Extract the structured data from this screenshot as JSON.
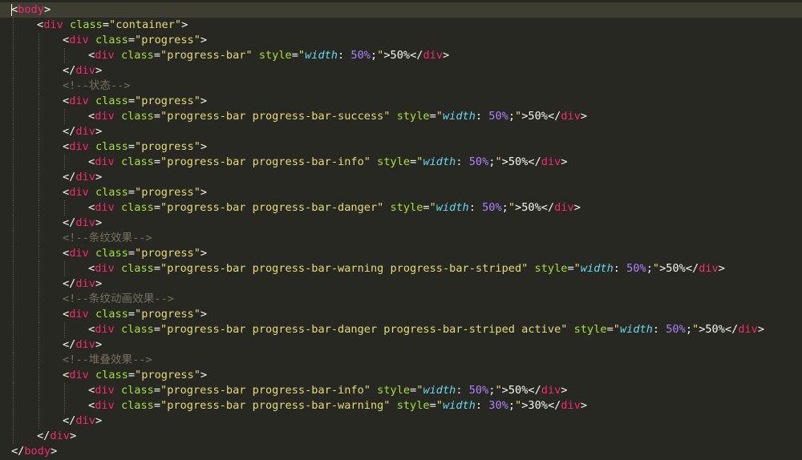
{
  "editor": {
    "lines": [
      {
        "indent": 0,
        "current": true,
        "tokens": [
          [
            "p",
            "<"
          ],
          [
            "t",
            "body"
          ],
          [
            "p",
            ">"
          ]
        ]
      },
      {
        "indent": 1,
        "tokens": [
          [
            "p",
            "<"
          ],
          [
            "t",
            "div"
          ],
          [
            "p",
            " "
          ],
          [
            "a",
            "class"
          ],
          [
            "p",
            "="
          ],
          [
            "s",
            "\"container\""
          ],
          [
            "p",
            ">"
          ]
        ]
      },
      {
        "indent": 2,
        "tokens": [
          [
            "p",
            "<"
          ],
          [
            "t",
            "div"
          ],
          [
            "p",
            " "
          ],
          [
            "a",
            "class"
          ],
          [
            "p",
            "="
          ],
          [
            "s",
            "\"progress\""
          ],
          [
            "p",
            ">"
          ]
        ]
      },
      {
        "indent": 3,
        "tokens": [
          [
            "p",
            "<"
          ],
          [
            "t",
            "div"
          ],
          [
            "p",
            " "
          ],
          [
            "a",
            "class"
          ],
          [
            "p",
            "="
          ],
          [
            "s",
            "\"progress-bar\""
          ],
          [
            "p",
            " "
          ],
          [
            "a",
            "style"
          ],
          [
            "p",
            "="
          ],
          [
            "s",
            "\""
          ],
          [
            "prop",
            "width"
          ],
          [
            "p",
            ": "
          ],
          [
            "num",
            "50%"
          ],
          [
            "p",
            ";"
          ],
          [
            "s",
            "\""
          ],
          [
            "p",
            ">50%</"
          ],
          [
            "t",
            "div"
          ],
          [
            "p",
            ">"
          ]
        ]
      },
      {
        "indent": 2,
        "tokens": [
          [
            "p",
            "</"
          ],
          [
            "t",
            "div"
          ],
          [
            "p",
            ">"
          ]
        ]
      },
      {
        "indent": 2,
        "tokens": [
          [
            "c",
            "<!--状态-->"
          ]
        ]
      },
      {
        "indent": 2,
        "tokens": [
          [
            "p",
            "<"
          ],
          [
            "t",
            "div"
          ],
          [
            "p",
            " "
          ],
          [
            "a",
            "class"
          ],
          [
            "p",
            "="
          ],
          [
            "s",
            "\"progress\""
          ],
          [
            "p",
            ">"
          ]
        ]
      },
      {
        "indent": 3,
        "tokens": [
          [
            "p",
            "<"
          ],
          [
            "t",
            "div"
          ],
          [
            "p",
            " "
          ],
          [
            "a",
            "class"
          ],
          [
            "p",
            "="
          ],
          [
            "s",
            "\"progress-bar progress-bar-success\""
          ],
          [
            "p",
            " "
          ],
          [
            "a",
            "style"
          ],
          [
            "p",
            "="
          ],
          [
            "s",
            "\""
          ],
          [
            "prop",
            "width"
          ],
          [
            "p",
            ": "
          ],
          [
            "num",
            "50%"
          ],
          [
            "p",
            ";"
          ],
          [
            "s",
            "\""
          ],
          [
            "p",
            ">50%</"
          ],
          [
            "t",
            "div"
          ],
          [
            "p",
            ">"
          ]
        ]
      },
      {
        "indent": 2,
        "tokens": [
          [
            "p",
            "</"
          ],
          [
            "t",
            "div"
          ],
          [
            "p",
            ">"
          ]
        ]
      },
      {
        "indent": 2,
        "tokens": [
          [
            "p",
            "<"
          ],
          [
            "t",
            "div"
          ],
          [
            "p",
            " "
          ],
          [
            "a",
            "class"
          ],
          [
            "p",
            "="
          ],
          [
            "s",
            "\"progress\""
          ],
          [
            "p",
            ">"
          ]
        ]
      },
      {
        "indent": 3,
        "tokens": [
          [
            "p",
            "<"
          ],
          [
            "t",
            "div"
          ],
          [
            "p",
            " "
          ],
          [
            "a",
            "class"
          ],
          [
            "p",
            "="
          ],
          [
            "s",
            "\"progress-bar progress-bar-info\""
          ],
          [
            "p",
            " "
          ],
          [
            "a",
            "style"
          ],
          [
            "p",
            "="
          ],
          [
            "s",
            "\""
          ],
          [
            "prop",
            "width"
          ],
          [
            "p",
            ": "
          ],
          [
            "num",
            "50%"
          ],
          [
            "p",
            ";"
          ],
          [
            "s",
            "\""
          ],
          [
            "p",
            ">50%</"
          ],
          [
            "t",
            "div"
          ],
          [
            "p",
            ">"
          ]
        ]
      },
      {
        "indent": 2,
        "tokens": [
          [
            "p",
            "</"
          ],
          [
            "t",
            "div"
          ],
          [
            "p",
            ">"
          ]
        ]
      },
      {
        "indent": 2,
        "tokens": [
          [
            "p",
            "<"
          ],
          [
            "t",
            "div"
          ],
          [
            "p",
            " "
          ],
          [
            "a",
            "class"
          ],
          [
            "p",
            "="
          ],
          [
            "s",
            "\"progress\""
          ],
          [
            "p",
            ">"
          ]
        ]
      },
      {
        "indent": 3,
        "tokens": [
          [
            "p",
            "<"
          ],
          [
            "t",
            "div"
          ],
          [
            "p",
            " "
          ],
          [
            "a",
            "class"
          ],
          [
            "p",
            "="
          ],
          [
            "s",
            "\"progress-bar progress-bar-danger\""
          ],
          [
            "p",
            " "
          ],
          [
            "a",
            "style"
          ],
          [
            "p",
            "="
          ],
          [
            "s",
            "\""
          ],
          [
            "prop",
            "width"
          ],
          [
            "p",
            ": "
          ],
          [
            "num",
            "50%"
          ],
          [
            "p",
            ";"
          ],
          [
            "s",
            "\""
          ],
          [
            "p",
            ">50%</"
          ],
          [
            "t",
            "div"
          ],
          [
            "p",
            ">"
          ]
        ]
      },
      {
        "indent": 2,
        "tokens": [
          [
            "p",
            "</"
          ],
          [
            "t",
            "div"
          ],
          [
            "p",
            ">"
          ]
        ]
      },
      {
        "indent": 2,
        "tokens": [
          [
            "c",
            "<!--条纹效果-->"
          ]
        ]
      },
      {
        "indent": 2,
        "tokens": [
          [
            "p",
            "<"
          ],
          [
            "t",
            "div"
          ],
          [
            "p",
            " "
          ],
          [
            "a",
            "class"
          ],
          [
            "p",
            "="
          ],
          [
            "s",
            "\"progress\""
          ],
          [
            "p",
            ">"
          ]
        ]
      },
      {
        "indent": 3,
        "tokens": [
          [
            "p",
            "<"
          ],
          [
            "t",
            "div"
          ],
          [
            "p",
            " "
          ],
          [
            "a",
            "class"
          ],
          [
            "p",
            "="
          ],
          [
            "s",
            "\"progress-bar progress-bar-warning progress-bar-striped\""
          ],
          [
            "p",
            " "
          ],
          [
            "a",
            "style"
          ],
          [
            "p",
            "="
          ],
          [
            "s",
            "\""
          ],
          [
            "prop",
            "width"
          ],
          [
            "p",
            ": "
          ],
          [
            "num",
            "50%"
          ],
          [
            "p",
            ";"
          ],
          [
            "s",
            "\""
          ],
          [
            "p",
            ">50%</"
          ],
          [
            "t",
            "div"
          ],
          [
            "p",
            ">"
          ]
        ]
      },
      {
        "indent": 2,
        "tokens": [
          [
            "p",
            "</"
          ],
          [
            "t",
            "div"
          ],
          [
            "p",
            ">"
          ]
        ]
      },
      {
        "indent": 2,
        "tokens": [
          [
            "c",
            "<!--条纹动画效果-->"
          ]
        ]
      },
      {
        "indent": 2,
        "tokens": [
          [
            "p",
            "<"
          ],
          [
            "t",
            "div"
          ],
          [
            "p",
            " "
          ],
          [
            "a",
            "class"
          ],
          [
            "p",
            "="
          ],
          [
            "s",
            "\"progress\""
          ],
          [
            "p",
            ">"
          ]
        ]
      },
      {
        "indent": 3,
        "tokens": [
          [
            "p",
            "<"
          ],
          [
            "t",
            "div"
          ],
          [
            "p",
            " "
          ],
          [
            "a",
            "class"
          ],
          [
            "p",
            "="
          ],
          [
            "s",
            "\"progress-bar progress-bar-danger progress-bar-striped active\""
          ],
          [
            "p",
            " "
          ],
          [
            "a",
            "style"
          ],
          [
            "p",
            "="
          ],
          [
            "s",
            "\""
          ],
          [
            "prop",
            "width"
          ],
          [
            "p",
            ": "
          ],
          [
            "num",
            "50%"
          ],
          [
            "p",
            ";"
          ],
          [
            "s",
            "\""
          ],
          [
            "p",
            ">50%</"
          ],
          [
            "t",
            "div"
          ],
          [
            "p",
            ">"
          ]
        ]
      },
      {
        "indent": 2,
        "tokens": [
          [
            "p",
            "</"
          ],
          [
            "t",
            "div"
          ],
          [
            "p",
            ">"
          ]
        ]
      },
      {
        "indent": 2,
        "tokens": [
          [
            "c",
            "<!--堆叠效果-->"
          ]
        ]
      },
      {
        "indent": 2,
        "tokens": [
          [
            "p",
            "<"
          ],
          [
            "t",
            "div"
          ],
          [
            "p",
            " "
          ],
          [
            "a",
            "class"
          ],
          [
            "p",
            "="
          ],
          [
            "s",
            "\"progress\""
          ],
          [
            "p",
            ">"
          ]
        ]
      },
      {
        "indent": 3,
        "tokens": [
          [
            "p",
            "<"
          ],
          [
            "t",
            "div"
          ],
          [
            "p",
            " "
          ],
          [
            "a",
            "class"
          ],
          [
            "p",
            "="
          ],
          [
            "s",
            "\"progress-bar progress-bar-info\""
          ],
          [
            "p",
            " "
          ],
          [
            "a",
            "style"
          ],
          [
            "p",
            "="
          ],
          [
            "s",
            "\""
          ],
          [
            "prop",
            "width"
          ],
          [
            "p",
            ": "
          ],
          [
            "num",
            "50%"
          ],
          [
            "p",
            ";"
          ],
          [
            "s",
            "\""
          ],
          [
            "p",
            ">50%</"
          ],
          [
            "t",
            "div"
          ],
          [
            "p",
            ">"
          ]
        ]
      },
      {
        "indent": 3,
        "tokens": [
          [
            "p",
            "<"
          ],
          [
            "t",
            "div"
          ],
          [
            "p",
            " "
          ],
          [
            "a",
            "class"
          ],
          [
            "p",
            "="
          ],
          [
            "s",
            "\"progress-bar progress-bar-warning\""
          ],
          [
            "p",
            " "
          ],
          [
            "a",
            "style"
          ],
          [
            "p",
            "="
          ],
          [
            "s",
            "\""
          ],
          [
            "prop",
            "width"
          ],
          [
            "p",
            ": "
          ],
          [
            "num",
            "30%"
          ],
          [
            "p",
            ";"
          ],
          [
            "s",
            "\""
          ],
          [
            "p",
            ">30%</"
          ],
          [
            "t",
            "div"
          ],
          [
            "p",
            ">"
          ]
        ]
      },
      {
        "indent": 2,
        "tokens": [
          [
            "p",
            "</"
          ],
          [
            "t",
            "div"
          ],
          [
            "p",
            ">"
          ]
        ]
      },
      {
        "indent": 1,
        "tokens": [
          [
            "p",
            "</"
          ],
          [
            "t",
            "div"
          ],
          [
            "p",
            ">"
          ]
        ]
      },
      {
        "indent": 0,
        "tokens": [
          [
            "p",
            "</"
          ],
          [
            "t",
            "body"
          ],
          [
            "p",
            ">"
          ]
        ]
      }
    ]
  }
}
